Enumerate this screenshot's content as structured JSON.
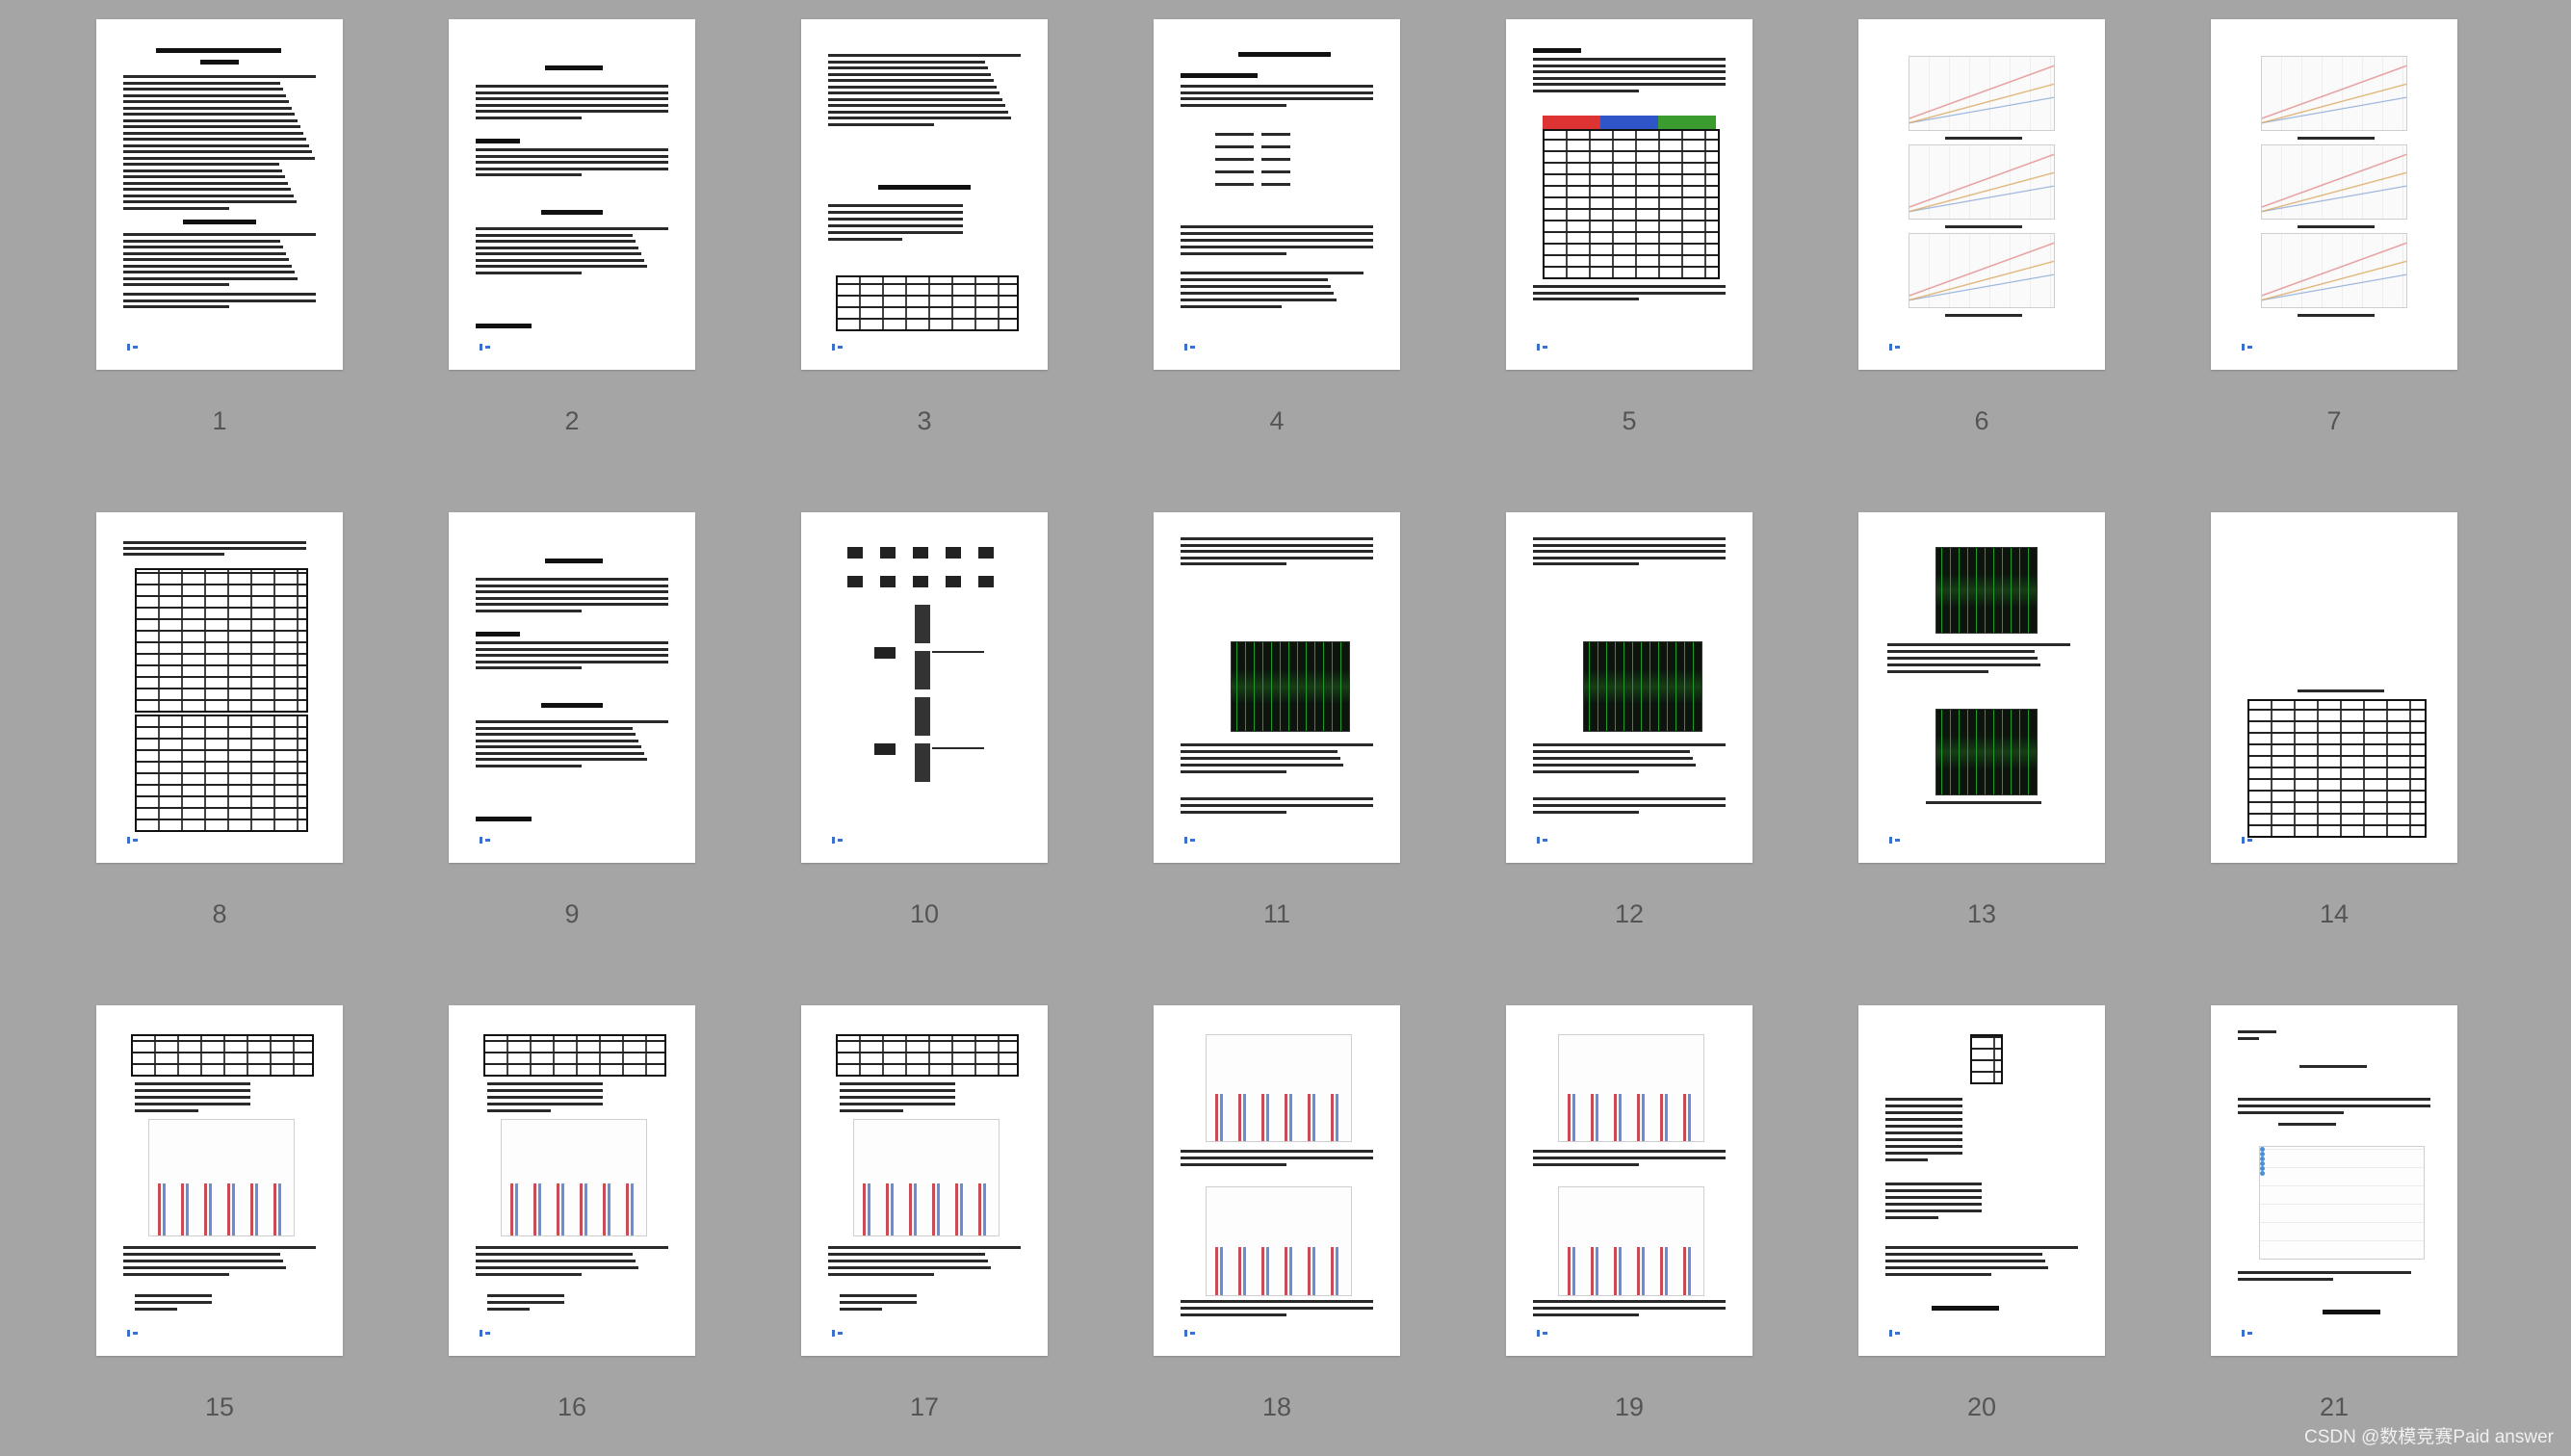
{
  "view": "document-thumbnail-grid",
  "pages": [
    {
      "number": "1",
      "kind": "title-text"
    },
    {
      "number": "2",
      "kind": "text"
    },
    {
      "number": "3",
      "kind": "text-table"
    },
    {
      "number": "4",
      "kind": "formula"
    },
    {
      "number": "5",
      "kind": "color-table"
    },
    {
      "number": "6",
      "kind": "line-figures"
    },
    {
      "number": "7",
      "kind": "line-figures"
    },
    {
      "number": "8",
      "kind": "tables"
    },
    {
      "number": "9",
      "kind": "text"
    },
    {
      "number": "10",
      "kind": "diagram"
    },
    {
      "number": "11",
      "kind": "dark-plot"
    },
    {
      "number": "12",
      "kind": "dark-plot"
    },
    {
      "number": "13",
      "kind": "dark-plots"
    },
    {
      "number": "14",
      "kind": "table"
    },
    {
      "number": "15",
      "kind": "bar-figure"
    },
    {
      "number": "16",
      "kind": "bar-figure"
    },
    {
      "number": "17",
      "kind": "bar-figure"
    },
    {
      "number": "18",
      "kind": "bar-figures"
    },
    {
      "number": "19",
      "kind": "bar-figures"
    },
    {
      "number": "20",
      "kind": "sparse-text"
    },
    {
      "number": "21",
      "kind": "scatter-figure"
    }
  ],
  "footer": {
    "credit": "CSDN @数模竞赛Paid answer"
  },
  "colors": {
    "background": "#a5a5a5",
    "page": "#ffffff",
    "page_number": "#555555",
    "link_marker": "#3b6fd0"
  }
}
